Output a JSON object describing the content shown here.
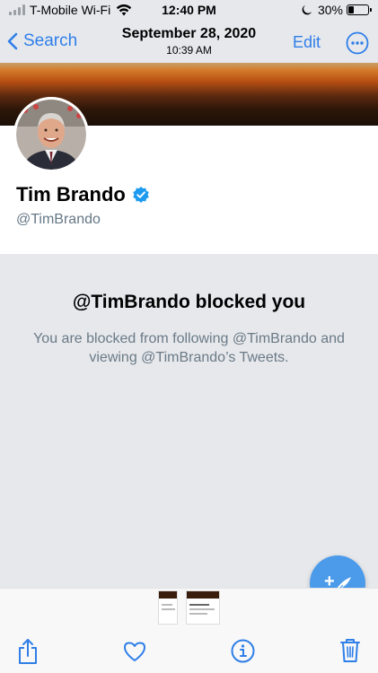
{
  "status_bar": {
    "carrier": "T-Mobile Wi-Fi",
    "time": "12:40 PM",
    "battery_percent": "30%",
    "battery_level": 0.3
  },
  "nav": {
    "back_label": "Search",
    "date": "September 28, 2020",
    "time": "10:39 AM",
    "edit_label": "Edit"
  },
  "profile": {
    "name": "Tim Brando",
    "handle": "@TimBrando",
    "verified": true
  },
  "blocked": {
    "title": "@TimBrando blocked you",
    "message": "You are blocked from following @TimBrando and viewing @TimBrando’s Tweets."
  },
  "colors": {
    "accent": "#2f7fe8",
    "twitter_blue": "#4b9bea",
    "muted_text": "#6b7a86",
    "background": "#e6e8ec"
  },
  "toolbar": {
    "icons": [
      "share-icon",
      "heart-icon",
      "info-icon",
      "trash-icon"
    ]
  }
}
